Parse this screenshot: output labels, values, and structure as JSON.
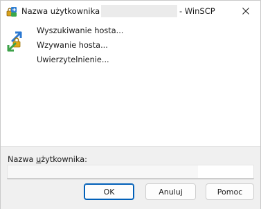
{
  "window": {
    "title_prefix": "Nazwa użytkownika -",
    "title_suffix": "- WinSCP",
    "close_symbol": "✕"
  },
  "icons": {
    "app": "winscp-app-icon",
    "status": "key-arrows-icon"
  },
  "steps": [
    "Wyszukiwanie hosta...",
    "Wzywanie hosta...",
    "Uwierzytelnienie..."
  ],
  "username_field": {
    "label_pre": "Nazwa ",
    "label_mnemonic": "u",
    "label_post": "żytkownika:",
    "value": "",
    "placeholder": ""
  },
  "buttons": {
    "ok": "OK",
    "cancel": "Anuluj",
    "help": "Pomoc"
  },
  "colors": {
    "accent": "#005fb8",
    "panel_bg": "#f0f0f0"
  }
}
